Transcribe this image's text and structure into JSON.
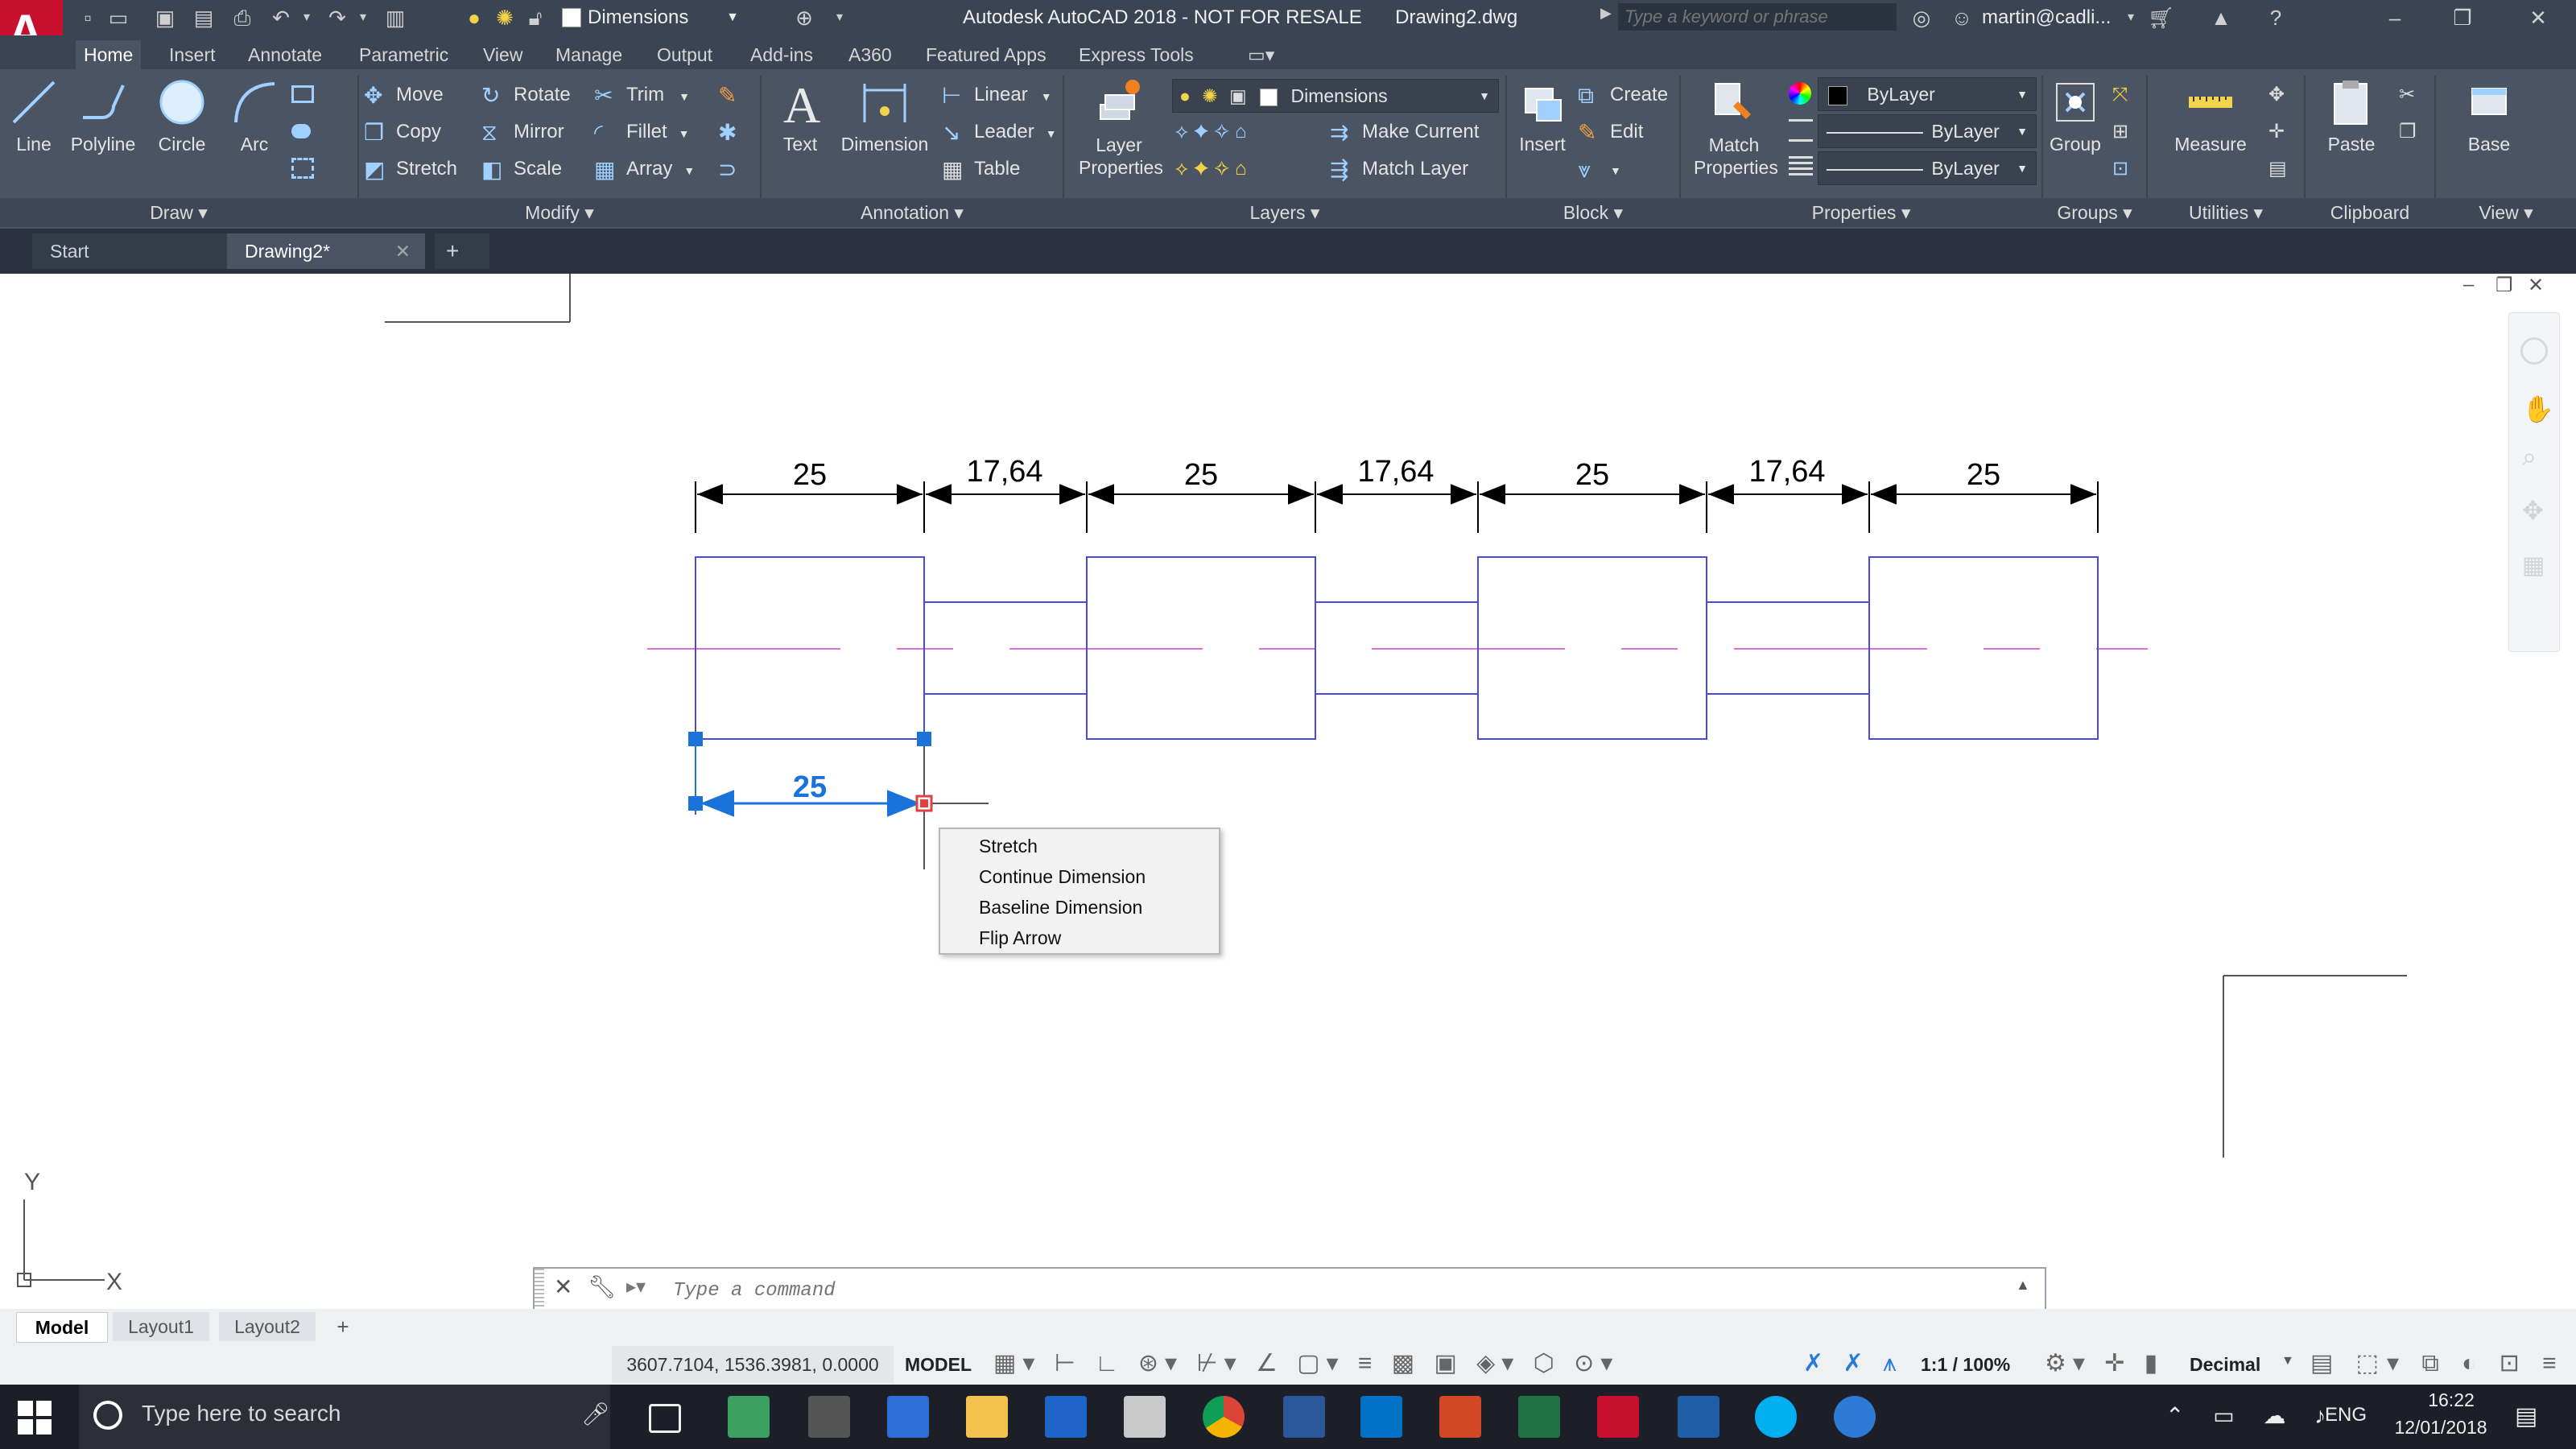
{
  "app": {
    "title": "Autodesk AutoCAD 2018 - NOT FOR RESALE",
    "filename": "Drawing2.dwg",
    "search_placeholder": "Type a keyword or phrase",
    "user": "martin@cadli...",
    "qa_layer_value": "Dimensions"
  },
  "ribbon_tabs": [
    "Home",
    "Insert",
    "Annotate",
    "Parametric",
    "View",
    "Manage",
    "Output",
    "Add-ins",
    "A360",
    "Featured Apps",
    "Express Tools"
  ],
  "draw": {
    "line": "Line",
    "polyline": "Polyline",
    "circle": "Circle",
    "arc": "Arc",
    "panel": "Draw"
  },
  "modify": {
    "move": "Move",
    "rotate": "Rotate",
    "trim": "Trim",
    "copy": "Copy",
    "mirror": "Mirror",
    "fillet": "Fillet",
    "stretch": "Stretch",
    "scale": "Scale",
    "array": "Array",
    "panel": "Modify"
  },
  "annotation": {
    "text": "Text",
    "dimension": "Dimension",
    "linear": "Linear",
    "leader": "Leader",
    "table": "Table",
    "panel": "Annotation"
  },
  "layers": {
    "layer_properties": "Layer Properties",
    "current_layer": "Dimensions",
    "make_current": "Make Current",
    "match_layer": "Match Layer",
    "panel": "Layers"
  },
  "block": {
    "insert": "Insert",
    "create": "Create",
    "edit": "Edit",
    "panel": "Block"
  },
  "properties": {
    "match": "Match Properties",
    "color": "ByLayer",
    "linetype": "ByLayer",
    "lineweight": "ByLayer",
    "panel": "Properties"
  },
  "groups": {
    "group": "Group",
    "panel": "Groups"
  },
  "utilities": {
    "measure": "Measure",
    "panel": "Utilities"
  },
  "clipboard": {
    "paste": "Paste",
    "panel": "Clipboard"
  },
  "view": {
    "base": "Base",
    "panel": "View"
  },
  "doc_tabs": [
    "Start",
    "Drawing2*"
  ],
  "drawing": {
    "dims_top": [
      "25",
      "17,64",
      "25",
      "17,64",
      "25",
      "17,64",
      "25"
    ],
    "dim_selected": "25"
  },
  "context_menu": [
    "Stretch",
    "Continue Dimension",
    "Baseline Dimension",
    "Flip Arrow"
  ],
  "ucs": {
    "x": "X",
    "y": "Y"
  },
  "command_placeholder": "Type a command",
  "layout_tabs": [
    "Model",
    "Layout1",
    "Layout2"
  ],
  "status": {
    "coords": "3607.7104, 1536.3981, 0.0000",
    "model": "MODEL",
    "scale": "1:1 / 100%",
    "units": "Decimal"
  },
  "taskbar": {
    "search_placeholder": "Type here to search",
    "lang": "ENG",
    "time": "16:22",
    "date": "12/01/2018"
  }
}
